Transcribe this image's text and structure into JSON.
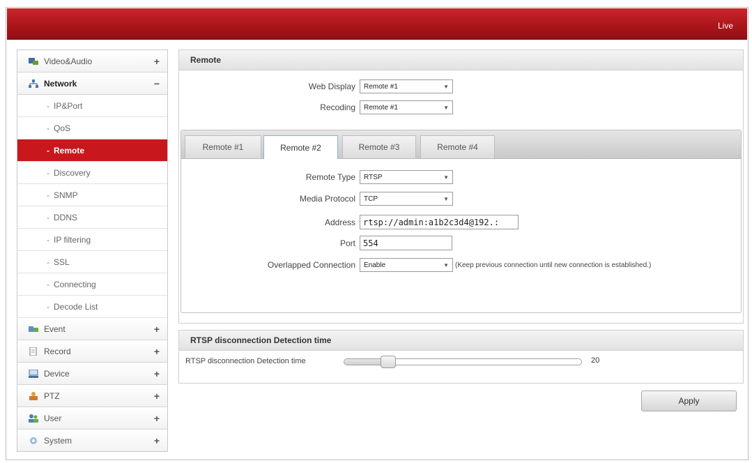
{
  "header": {
    "live_label": "Live",
    "accent": "#c8181e"
  },
  "sidebar": {
    "items": [
      {
        "label": "Video&Audio",
        "icon": "video-audio-icon",
        "toggle": "+"
      },
      {
        "label": "Network",
        "icon": "network-icon",
        "toggle": "−"
      },
      {
        "label": "Event",
        "icon": "event-icon",
        "toggle": "+"
      },
      {
        "label": "Record",
        "icon": "record-icon",
        "toggle": "+"
      },
      {
        "label": "Device",
        "icon": "device-icon",
        "toggle": "+"
      },
      {
        "label": "PTZ",
        "icon": "ptz-icon",
        "toggle": "+"
      },
      {
        "label": "User",
        "icon": "user-icon",
        "toggle": "+"
      },
      {
        "label": "System",
        "icon": "system-icon",
        "toggle": "+"
      }
    ],
    "network_sub": [
      "IP&Port",
      "QoS",
      "Remote",
      "Discovery",
      "SNMP",
      "DDNS",
      "IP filtering",
      "SSL",
      "Connecting",
      "Decode List"
    ],
    "bullet": "-"
  },
  "remote": {
    "title": "Remote",
    "web_display_label": "Web Display",
    "web_display_value": "Remote #1",
    "recording_label": "Recoding",
    "recording_value": "Remote #1",
    "tabs": [
      "Remote #1",
      "Remote #2",
      "Remote #3",
      "Remote #4"
    ],
    "active_tab": "Remote #2",
    "remote_type_label": "Remote Type",
    "remote_type_value": "RTSP",
    "media_protocol_label": "Media Protocol",
    "media_protocol_value": "TCP",
    "address_label": "Address",
    "address_value": "rtsp://admin:a1b2c3d4@192.:",
    "port_label": "Port",
    "port_value": "554",
    "overlapped_label": "Overlapped Connection",
    "overlapped_value": "Enable",
    "overlapped_note": "(Keep previous connection until new connection is established.)"
  },
  "rtsp": {
    "title": "RTSP disconnection Detection time",
    "slider_label": "RTSP disconnection Detection time",
    "slider_value": "20",
    "slider_fraction": 0.17
  },
  "apply_label": "Apply"
}
